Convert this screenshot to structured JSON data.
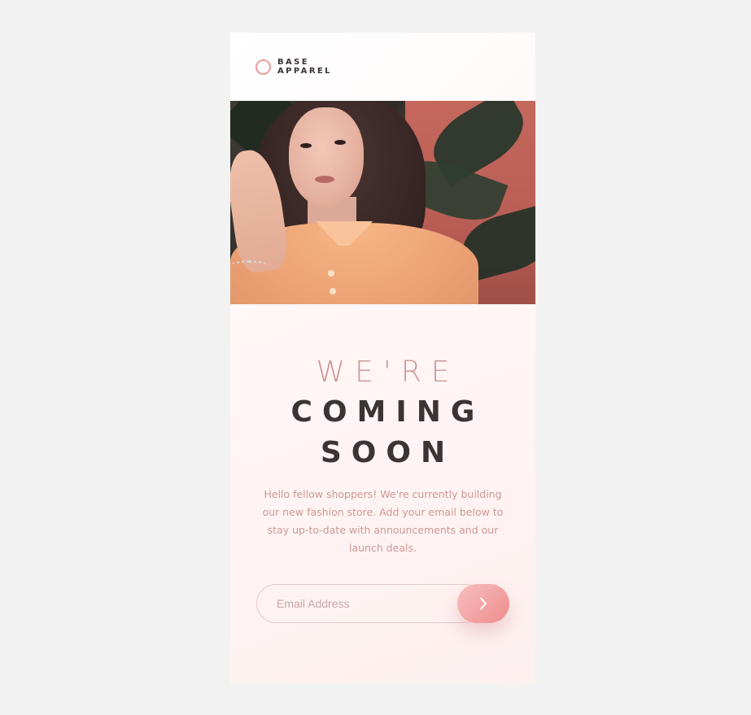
{
  "brand": {
    "line1": "BASE",
    "line2": "APPAREL",
    "accent_color": "#eb9b9b"
  },
  "hero": {
    "alt": "Woman in an orange shirt in front of plants"
  },
  "headline": {
    "light": "WE'RE",
    "bold_line1": "COMING",
    "bold_line2": "SOON"
  },
  "description": "Hello fellow shoppers! We're currently building our new fashion store. Add your email below to stay up-to-date with announcements and our launch deals.",
  "form": {
    "email_placeholder": "Email Address",
    "submit_icon": "chevron-right-icon"
  },
  "colors": {
    "page_background": "#f2f2f2",
    "heading_dark": "#3b3435",
    "pink_text": "#ce9797",
    "button_gradient_start": "#f8bfbf",
    "button_gradient_end": "#ee8c8c"
  }
}
